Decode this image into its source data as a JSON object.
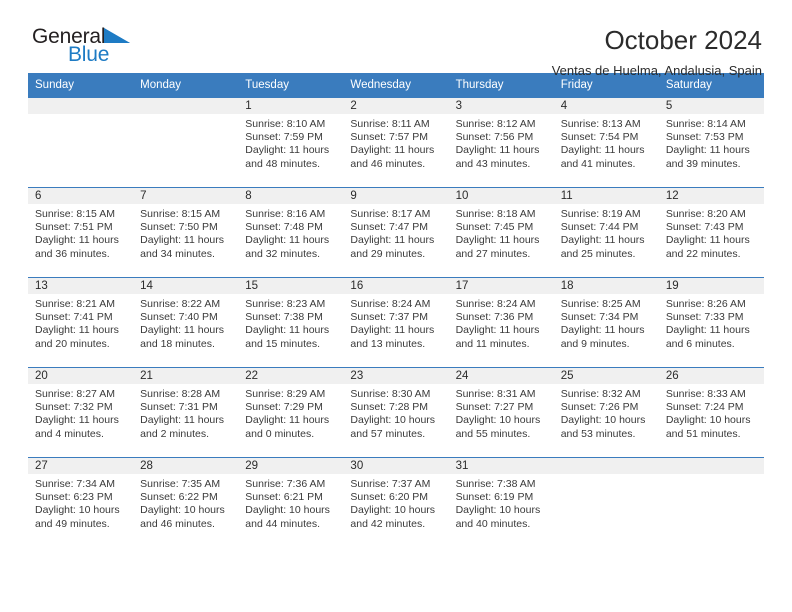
{
  "brand": {
    "line1": "General",
    "line2": "Blue",
    "logo_icon": "blue-triangle-logo",
    "accent_color": "#1e7bc4"
  },
  "header": {
    "title": "October 2024",
    "subtitle": "Ventas de Huelma, Andalusia, Spain"
  },
  "theme": {
    "header_blue": "#3a7cbe",
    "band_gray": "#f0f0f0",
    "text_dark": "#2b2b2b"
  },
  "weekday_headers": [
    "Sunday",
    "Monday",
    "Tuesday",
    "Wednesday",
    "Thursday",
    "Friday",
    "Saturday"
  ],
  "weeks": [
    [
      {
        "day": "",
        "sunrise": "",
        "sunset": "",
        "daylight": "",
        "empty": true
      },
      {
        "day": "",
        "sunrise": "",
        "sunset": "",
        "daylight": "",
        "empty": true
      },
      {
        "day": "1",
        "sunrise": "Sunrise: 8:10 AM",
        "sunset": "Sunset: 7:59 PM",
        "daylight": "Daylight: 11 hours and 48 minutes."
      },
      {
        "day": "2",
        "sunrise": "Sunrise: 8:11 AM",
        "sunset": "Sunset: 7:57 PM",
        "daylight": "Daylight: 11 hours and 46 minutes."
      },
      {
        "day": "3",
        "sunrise": "Sunrise: 8:12 AM",
        "sunset": "Sunset: 7:56 PM",
        "daylight": "Daylight: 11 hours and 43 minutes."
      },
      {
        "day": "4",
        "sunrise": "Sunrise: 8:13 AM",
        "sunset": "Sunset: 7:54 PM",
        "daylight": "Daylight: 11 hours and 41 minutes."
      },
      {
        "day": "5",
        "sunrise": "Sunrise: 8:14 AM",
        "sunset": "Sunset: 7:53 PM",
        "daylight": "Daylight: 11 hours and 39 minutes."
      }
    ],
    [
      {
        "day": "6",
        "sunrise": "Sunrise: 8:15 AM",
        "sunset": "Sunset: 7:51 PM",
        "daylight": "Daylight: 11 hours and 36 minutes."
      },
      {
        "day": "7",
        "sunrise": "Sunrise: 8:15 AM",
        "sunset": "Sunset: 7:50 PM",
        "daylight": "Daylight: 11 hours and 34 minutes."
      },
      {
        "day": "8",
        "sunrise": "Sunrise: 8:16 AM",
        "sunset": "Sunset: 7:48 PM",
        "daylight": "Daylight: 11 hours and 32 minutes."
      },
      {
        "day": "9",
        "sunrise": "Sunrise: 8:17 AM",
        "sunset": "Sunset: 7:47 PM",
        "daylight": "Daylight: 11 hours and 29 minutes."
      },
      {
        "day": "10",
        "sunrise": "Sunrise: 8:18 AM",
        "sunset": "Sunset: 7:45 PM",
        "daylight": "Daylight: 11 hours and 27 minutes."
      },
      {
        "day": "11",
        "sunrise": "Sunrise: 8:19 AM",
        "sunset": "Sunset: 7:44 PM",
        "daylight": "Daylight: 11 hours and 25 minutes."
      },
      {
        "day": "12",
        "sunrise": "Sunrise: 8:20 AM",
        "sunset": "Sunset: 7:43 PM",
        "daylight": "Daylight: 11 hours and 22 minutes."
      }
    ],
    [
      {
        "day": "13",
        "sunrise": "Sunrise: 8:21 AM",
        "sunset": "Sunset: 7:41 PM",
        "daylight": "Daylight: 11 hours and 20 minutes."
      },
      {
        "day": "14",
        "sunrise": "Sunrise: 8:22 AM",
        "sunset": "Sunset: 7:40 PM",
        "daylight": "Daylight: 11 hours and 18 minutes."
      },
      {
        "day": "15",
        "sunrise": "Sunrise: 8:23 AM",
        "sunset": "Sunset: 7:38 PM",
        "daylight": "Daylight: 11 hours and 15 minutes."
      },
      {
        "day": "16",
        "sunrise": "Sunrise: 8:24 AM",
        "sunset": "Sunset: 7:37 PM",
        "daylight": "Daylight: 11 hours and 13 minutes."
      },
      {
        "day": "17",
        "sunrise": "Sunrise: 8:24 AM",
        "sunset": "Sunset: 7:36 PM",
        "daylight": "Daylight: 11 hours and 11 minutes."
      },
      {
        "day": "18",
        "sunrise": "Sunrise: 8:25 AM",
        "sunset": "Sunset: 7:34 PM",
        "daylight": "Daylight: 11 hours and 9 minutes."
      },
      {
        "day": "19",
        "sunrise": "Sunrise: 8:26 AM",
        "sunset": "Sunset: 7:33 PM",
        "daylight": "Daylight: 11 hours and 6 minutes."
      }
    ],
    [
      {
        "day": "20",
        "sunrise": "Sunrise: 8:27 AM",
        "sunset": "Sunset: 7:32 PM",
        "daylight": "Daylight: 11 hours and 4 minutes."
      },
      {
        "day": "21",
        "sunrise": "Sunrise: 8:28 AM",
        "sunset": "Sunset: 7:31 PM",
        "daylight": "Daylight: 11 hours and 2 minutes."
      },
      {
        "day": "22",
        "sunrise": "Sunrise: 8:29 AM",
        "sunset": "Sunset: 7:29 PM",
        "daylight": "Daylight: 11 hours and 0 minutes."
      },
      {
        "day": "23",
        "sunrise": "Sunrise: 8:30 AM",
        "sunset": "Sunset: 7:28 PM",
        "daylight": "Daylight: 10 hours and 57 minutes."
      },
      {
        "day": "24",
        "sunrise": "Sunrise: 8:31 AM",
        "sunset": "Sunset: 7:27 PM",
        "daylight": "Daylight: 10 hours and 55 minutes."
      },
      {
        "day": "25",
        "sunrise": "Sunrise: 8:32 AM",
        "sunset": "Sunset: 7:26 PM",
        "daylight": "Daylight: 10 hours and 53 minutes."
      },
      {
        "day": "26",
        "sunrise": "Sunrise: 8:33 AM",
        "sunset": "Sunset: 7:24 PM",
        "daylight": "Daylight: 10 hours and 51 minutes."
      }
    ],
    [
      {
        "day": "27",
        "sunrise": "Sunrise: 7:34 AM",
        "sunset": "Sunset: 6:23 PM",
        "daylight": "Daylight: 10 hours and 49 minutes."
      },
      {
        "day": "28",
        "sunrise": "Sunrise: 7:35 AM",
        "sunset": "Sunset: 6:22 PM",
        "daylight": "Daylight: 10 hours and 46 minutes."
      },
      {
        "day": "29",
        "sunrise": "Sunrise: 7:36 AM",
        "sunset": "Sunset: 6:21 PM",
        "daylight": "Daylight: 10 hours and 44 minutes."
      },
      {
        "day": "30",
        "sunrise": "Sunrise: 7:37 AM",
        "sunset": "Sunset: 6:20 PM",
        "daylight": "Daylight: 10 hours and 42 minutes."
      },
      {
        "day": "31",
        "sunrise": "Sunrise: 7:38 AM",
        "sunset": "Sunset: 6:19 PM",
        "daylight": "Daylight: 10 hours and 40 minutes."
      },
      {
        "day": "",
        "sunrise": "",
        "sunset": "",
        "daylight": "",
        "empty": true
      },
      {
        "day": "",
        "sunrise": "",
        "sunset": "",
        "daylight": "",
        "empty": true
      }
    ]
  ]
}
